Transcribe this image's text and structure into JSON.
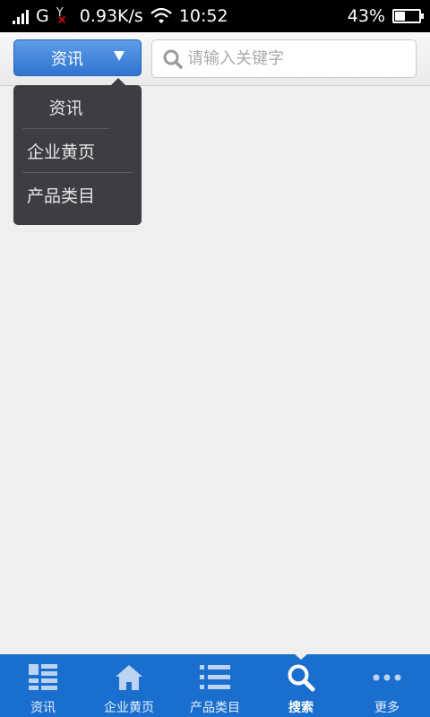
{
  "status_bar": {
    "network_type": "G",
    "speed": "0.93K/s",
    "time": "10:52",
    "battery_percent": "43%",
    "battery_level": 0.43
  },
  "top_bar": {
    "category_label": "资讯",
    "search_placeholder": "请输入关键字"
  },
  "dropdown": {
    "items": [
      {
        "label": "资讯"
      },
      {
        "label": "企业黄页"
      },
      {
        "label": "产品类目"
      }
    ]
  },
  "bottom_nav": {
    "active_index": 3,
    "items": [
      {
        "label": "资讯",
        "icon": "list-grid-icon"
      },
      {
        "label": "企业黄页",
        "icon": "home-icon"
      },
      {
        "label": "产品类目",
        "icon": "bullet-list-icon"
      },
      {
        "label": "搜索",
        "icon": "search-icon"
      },
      {
        "label": "更多",
        "icon": "more-dots-icon"
      }
    ]
  },
  "colors": {
    "accent": "#1a6fce",
    "dropdown_bg": "#3d3e42",
    "page_bg": "#efefef"
  }
}
